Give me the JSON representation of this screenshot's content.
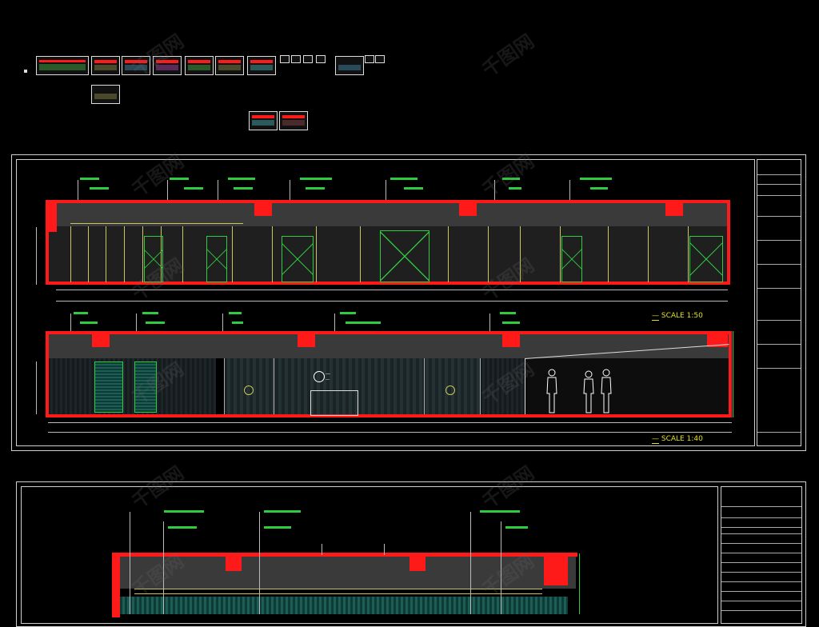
{
  "watermark": {
    "text": "千图网"
  },
  "elevations": {
    "top_annotations": [
      "—",
      "—",
      "—",
      "—",
      "—",
      "—"
    ],
    "mid_annotations": [
      "—",
      "—",
      "—",
      "—",
      "—"
    ],
    "bottom_annotations": [
      "—",
      "—",
      "—",
      "—",
      "—"
    ],
    "caption_1": {
      "text": "—",
      "scale": "SCALE 1:50"
    },
    "caption_2": {
      "text": "—",
      "scale": "SCALE 1:40"
    },
    "logo_text": "—",
    "logo_sub": "—"
  },
  "colors": {
    "background": "#000000",
    "wall_outline": "#ff1a1a",
    "annotation": "#2ecc40",
    "caption": "#e0e020",
    "frame": "#cfcfcf"
  },
  "icons": [
    "door-icon",
    "human-figure-icon",
    "logo-mark-icon"
  ]
}
